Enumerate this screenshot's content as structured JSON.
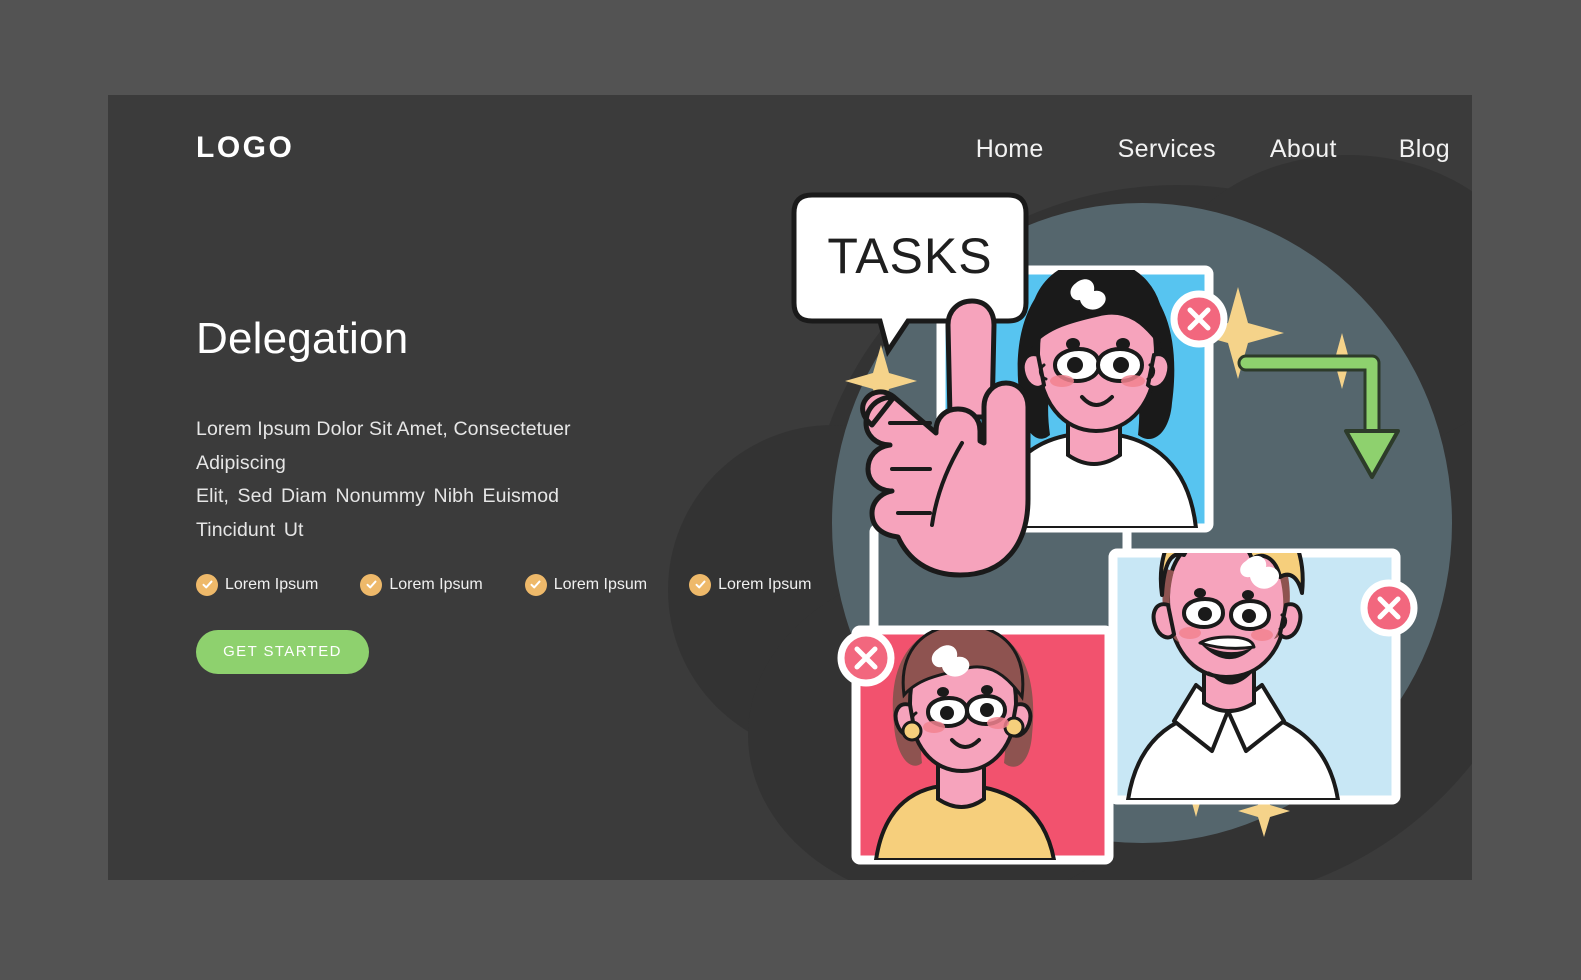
{
  "colors": {
    "page_background": "#535353",
    "panel_background": "#3b3b3b",
    "cloud_blob": "#333333",
    "slate_blob": "#55666d",
    "accent_green": "#8ed16e",
    "accent_amber": "#eeb96a",
    "accent_pink": "#f2677e",
    "sparkle_yellow": "#f5d38a",
    "card_blue": "#57c4f0",
    "card_lightblue": "#c8e7f5",
    "card_pink": "#f2526e",
    "skin_pink": "#f6a3bc",
    "hair_black": "#1a1a1a",
    "hair_blond": "#f6cf7c",
    "hair_brown": "#8e5350",
    "shirt_yellow": "#f6cf7c",
    "text_white": "#ffffff",
    "text_body": "#e6e6e6",
    "outline": "#222222"
  },
  "header": {
    "logo": "LOGO",
    "nav": [
      {
        "label": "Home"
      },
      {
        "label": "Services"
      },
      {
        "label": "About"
      },
      {
        "label": "Blog"
      }
    ]
  },
  "hero": {
    "title": "Delegation",
    "description_line1": "Lorem Ipsum Dolor Sit Amet, Consectetuer Adipiscing",
    "description_line2": "Elit, Sed Diam Nonummy Nibh Euismod Tincidunt Ut",
    "features": [
      {
        "label": "Lorem Ipsum",
        "icon": "check-circle-icon"
      },
      {
        "label": "Lorem Ipsum",
        "icon": "check-circle-icon"
      },
      {
        "label": "Lorem Ipsum",
        "icon": "check-circle-icon"
      },
      {
        "label": "Lorem Ipsum",
        "icon": "check-circle-icon"
      }
    ],
    "cta_label": "GET STARTED"
  },
  "illustration": {
    "name": "delegation-video-call-illustration",
    "speech_bubble_text": "TASKS",
    "cards": [
      {
        "name": "video-card-woman-dark-hair",
        "background_color": "#57c4f0",
        "person": "woman with black hair, white hair clip, white top",
        "close_button": "close-x-icon"
      },
      {
        "name": "video-card-boy-blond",
        "background_color": "#c8e7f5",
        "person": "boy with blond hair, white collared shirt, smiling",
        "close_button": "close-x-icon"
      },
      {
        "name": "video-card-woman-brown-hair",
        "background_color": "#f2526e",
        "person": "woman with brown hair, gold earrings, yellow top",
        "close_button": "close-x-icon"
      }
    ],
    "arrows": [
      {
        "name": "delegation-arrow-left",
        "direction": "down",
        "color": "#8ed16e"
      },
      {
        "name": "delegation-arrow-right",
        "direction": "down",
        "color": "#8ed16e"
      }
    ],
    "sparkle_count": 6,
    "pointing_hand": "index-finger-pointing-up"
  }
}
